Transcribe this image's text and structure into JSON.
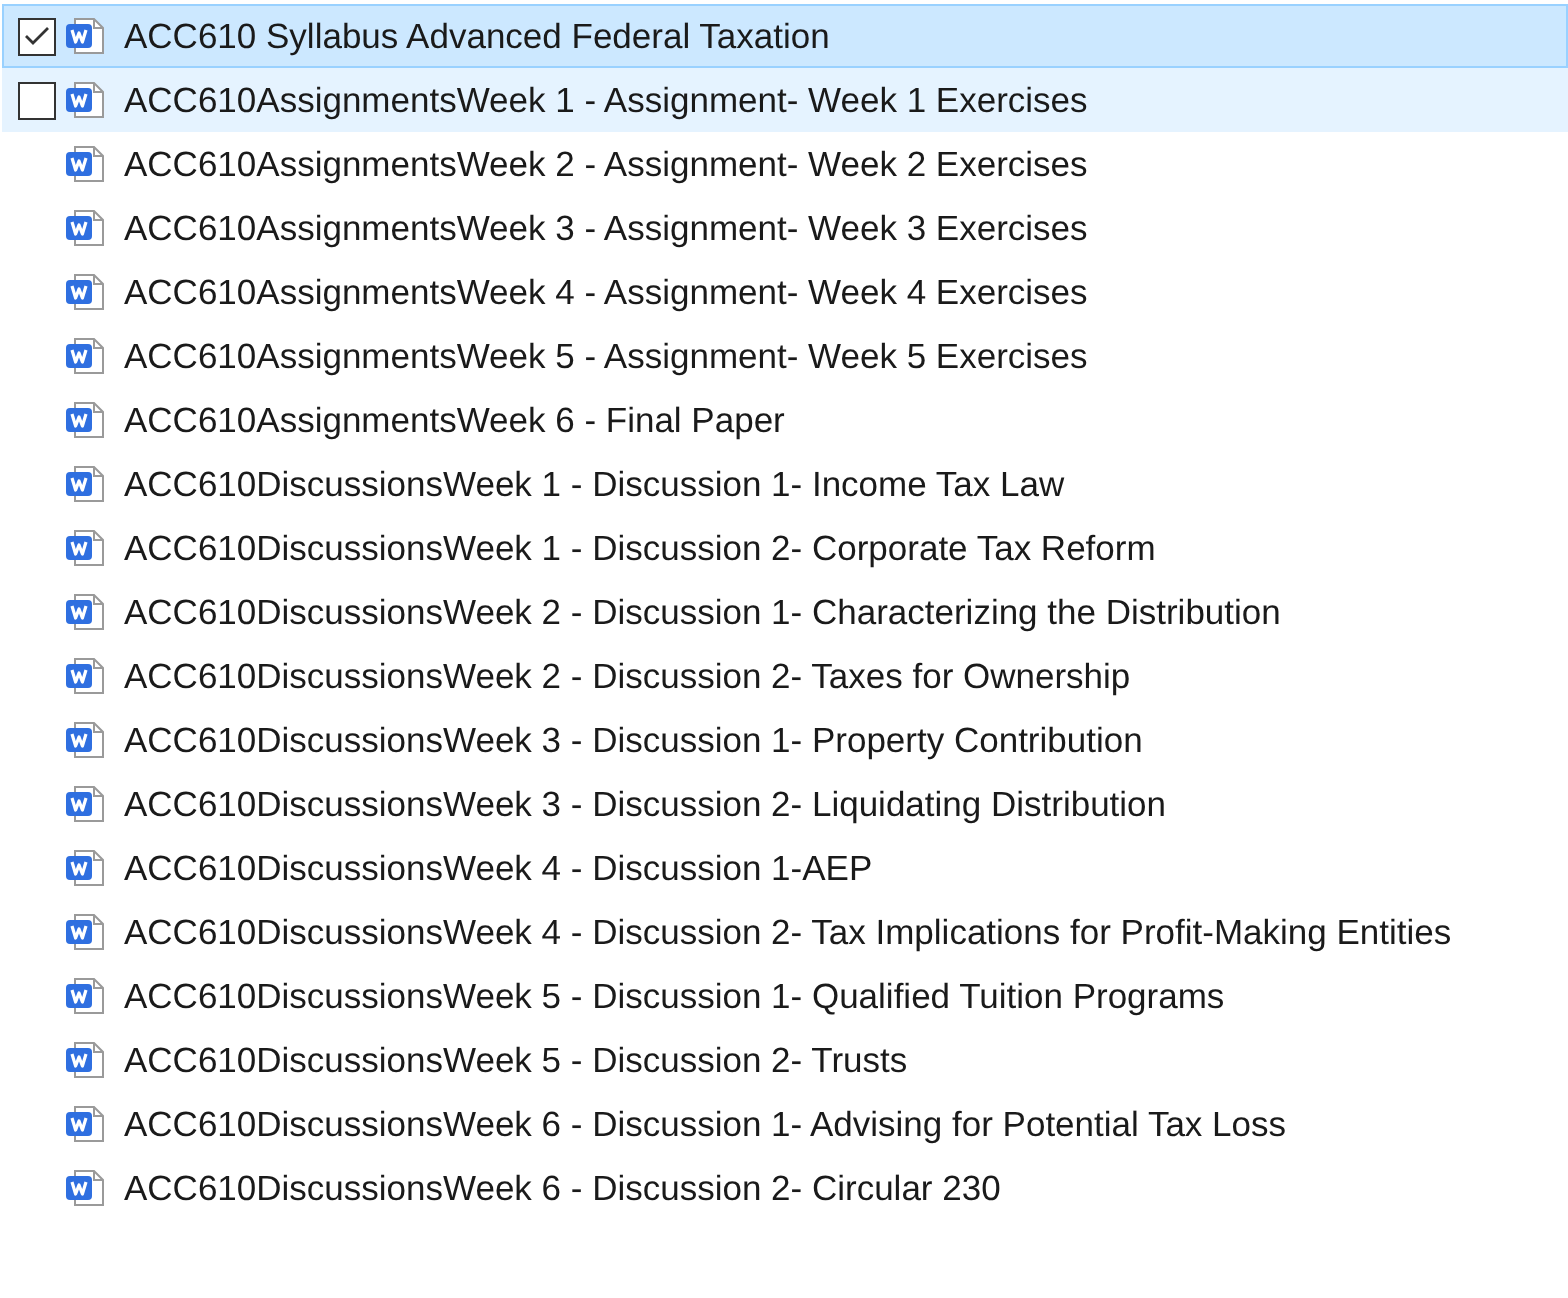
{
  "files": [
    {
      "name": "ACC610 Syllabus Advanced Federal Taxation",
      "selected": true,
      "checked": true
    },
    {
      "name": "ACC610AssignmentsWeek 1 - Assignment- Week 1 Exercises",
      "selected": false,
      "hovered": true,
      "checked": false
    },
    {
      "name": "ACC610AssignmentsWeek 2 - Assignment- Week 2 Exercises",
      "selected": false,
      "hovered": false
    },
    {
      "name": "ACC610AssignmentsWeek 3 - Assignment- Week 3 Exercises",
      "selected": false,
      "hovered": false
    },
    {
      "name": "ACC610AssignmentsWeek 4 - Assignment- Week 4 Exercises",
      "selected": false,
      "hovered": false
    },
    {
      "name": "ACC610AssignmentsWeek 5 - Assignment- Week 5 Exercises",
      "selected": false,
      "hovered": false
    },
    {
      "name": "ACC610AssignmentsWeek 6 - Final Paper",
      "selected": false,
      "hovered": false
    },
    {
      "name": "ACC610DiscussionsWeek 1 - Discussion 1- Income Tax Law",
      "selected": false,
      "hovered": false
    },
    {
      "name": "ACC610DiscussionsWeek 1 - Discussion 2- Corporate Tax Reform",
      "selected": false,
      "hovered": false
    },
    {
      "name": "ACC610DiscussionsWeek 2 - Discussion 1- Characterizing the Distribution",
      "selected": false,
      "hovered": false
    },
    {
      "name": "ACC610DiscussionsWeek 2 - Discussion 2- Taxes for Ownership",
      "selected": false,
      "hovered": false
    },
    {
      "name": "ACC610DiscussionsWeek 3 - Discussion 1- Property Contribution",
      "selected": false,
      "hovered": false
    },
    {
      "name": "ACC610DiscussionsWeek 3 - Discussion 2- Liquidating Distribution",
      "selected": false,
      "hovered": false
    },
    {
      "name": "ACC610DiscussionsWeek 4 - Discussion 1-AEP",
      "selected": false,
      "hovered": false
    },
    {
      "name": "ACC610DiscussionsWeek 4 - Discussion 2- Tax Implications for Profit-Making Entities",
      "selected": false,
      "hovered": false
    },
    {
      "name": "ACC610DiscussionsWeek 5 - Discussion 1- Qualified Tuition Programs",
      "selected": false,
      "hovered": false
    },
    {
      "name": "ACC610DiscussionsWeek 5 - Discussion 2- Trusts",
      "selected": false,
      "hovered": false
    },
    {
      "name": "ACC610DiscussionsWeek 6 - Discussion 1- Advising for Potential Tax Loss",
      "selected": false,
      "hovered": false
    },
    {
      "name": "ACC610DiscussionsWeek 6 - Discussion 2- Circular 230",
      "selected": false,
      "hovered": false
    }
  ]
}
